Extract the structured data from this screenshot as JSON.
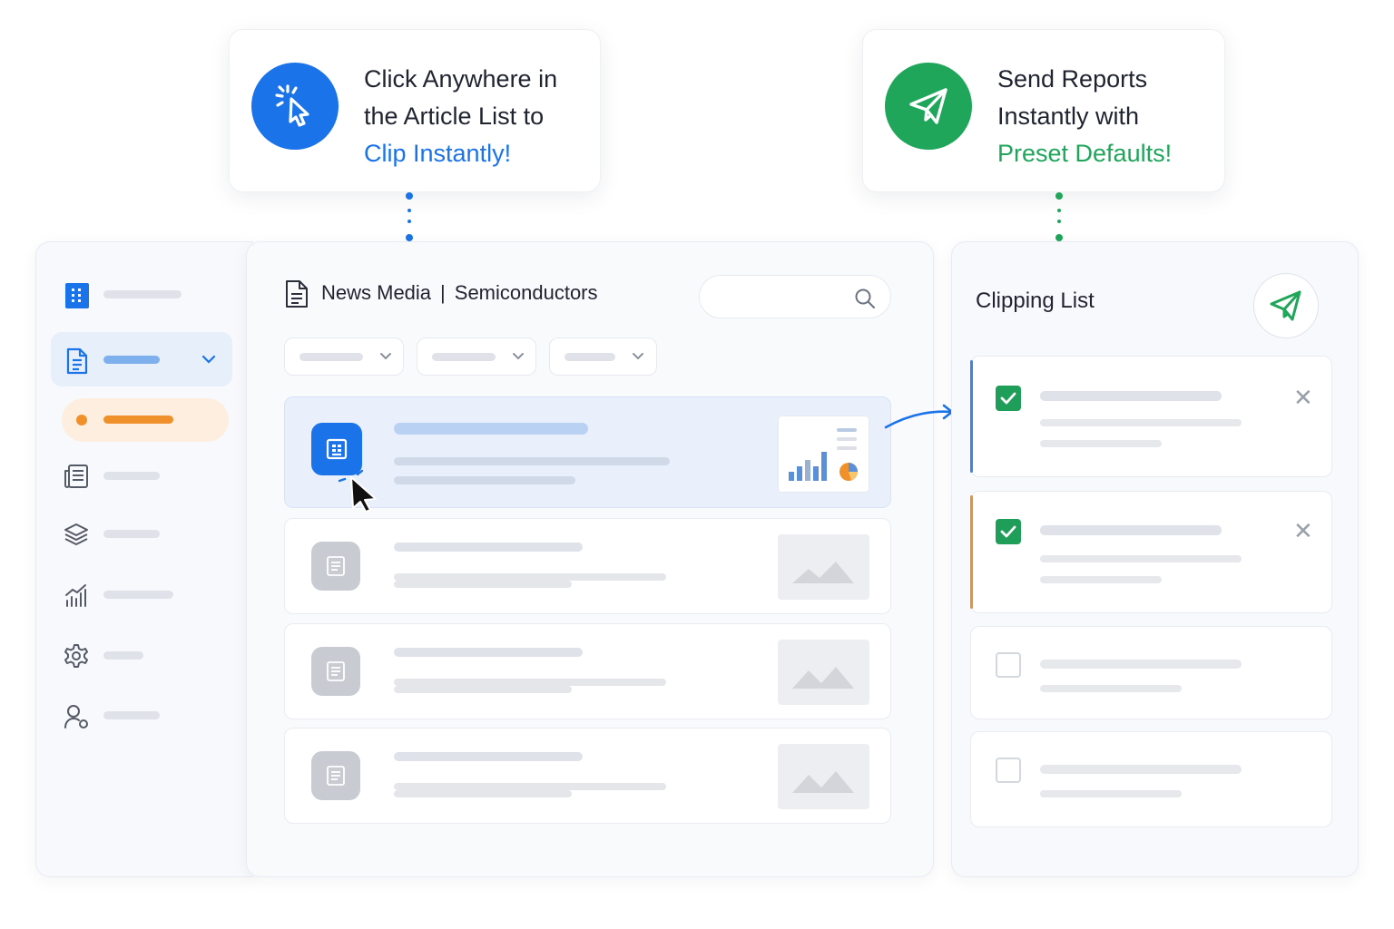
{
  "callouts": {
    "clip": {
      "line1": "Click Anywhere in",
      "line2": "the Article List to",
      "highlight": "Clip Instantly!",
      "icon": "cursor-click-icon",
      "color": "#1a73e8"
    },
    "send": {
      "line1": "Send Reports",
      "line2": "Instantly with",
      "highlight": "Preset Defaults!",
      "icon": "paper-plane-icon",
      "color": "#1fa65a"
    }
  },
  "sidebar": {
    "items": [
      {
        "icon": "building-icon",
        "state": "normal"
      },
      {
        "icon": "document-icon",
        "state": "selected",
        "expandable": true
      },
      {
        "icon": "dot-icon",
        "state": "highlighted-subitem"
      },
      {
        "icon": "newspaper-icon",
        "state": "normal"
      },
      {
        "icon": "layers-icon",
        "state": "normal"
      },
      {
        "icon": "chart-icon",
        "state": "normal"
      },
      {
        "icon": "gear-icon",
        "state": "normal"
      },
      {
        "icon": "user-icon",
        "state": "normal"
      }
    ]
  },
  "header": {
    "source": "News Media",
    "separator": "|",
    "topic": "Semiconductors",
    "search_placeholder": ""
  },
  "filters": [
    {
      "icon": "chevron-down-icon"
    },
    {
      "icon": "chevron-down-icon"
    },
    {
      "icon": "chevron-down-icon"
    }
  ],
  "articles": [
    {
      "state": "hovered",
      "thumbnail": "chart-thumbnail"
    },
    {
      "state": "normal",
      "thumbnail": "image-placeholder"
    },
    {
      "state": "normal",
      "thumbnail": "image-placeholder"
    },
    {
      "state": "normal",
      "thumbnail": "image-placeholder"
    }
  ],
  "clipping": {
    "title": "Clipping List",
    "send_icon": "paper-plane-icon",
    "items": [
      {
        "checked": true,
        "accent": "#3a86e8",
        "removable": true
      },
      {
        "checked": true,
        "accent": "#f0902a",
        "removable": true
      },
      {
        "checked": false,
        "removable": false
      },
      {
        "checked": false,
        "removable": false
      }
    ],
    "remove_symbol": "✕"
  },
  "colors": {
    "blue": "#1a73e8",
    "green": "#1fa65a",
    "orange": "#f0902a"
  }
}
